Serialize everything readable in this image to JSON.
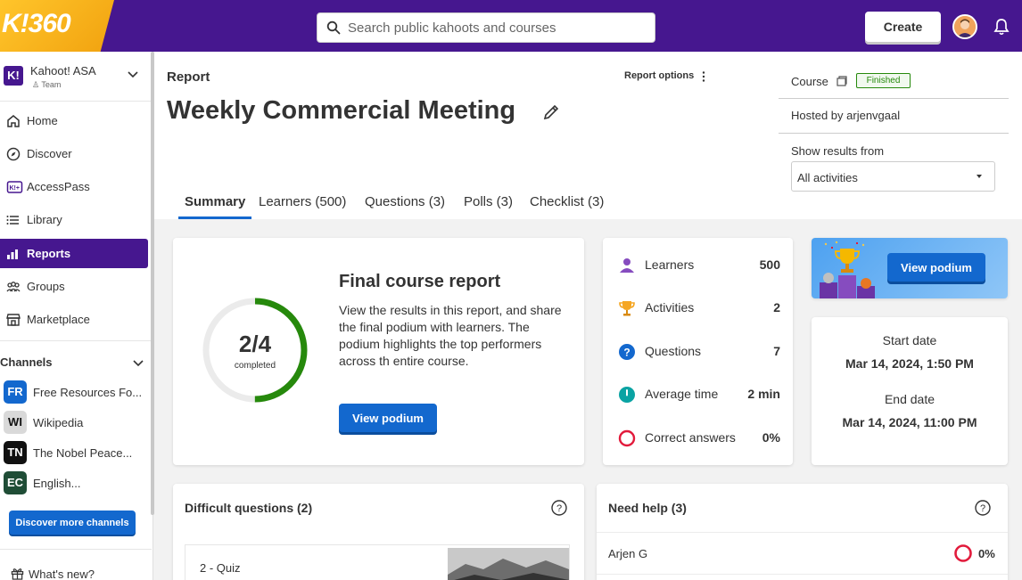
{
  "app": {
    "logo_text": "K!360",
    "search_placeholder": "Search public kahoots and courses",
    "create_label": "Create"
  },
  "sidebar": {
    "org_name": "Kahoot! ASA",
    "org_sub": "Team",
    "nav": [
      {
        "label": "Home",
        "icon": "home-icon"
      },
      {
        "label": "Discover",
        "icon": "compass-icon"
      },
      {
        "label": "AccessPass",
        "icon": "accesspass-icon"
      },
      {
        "label": "Library",
        "icon": "list-icon"
      },
      {
        "label": "Reports",
        "icon": "bar-chart-icon",
        "active": true
      },
      {
        "label": "Groups",
        "icon": "people-icon"
      },
      {
        "label": "Marketplace",
        "icon": "store-icon"
      }
    ],
    "channels_heading": "Channels",
    "channels": [
      {
        "badge": "FR",
        "label": "Free Resources Fo...",
        "color": "#1368ce"
      },
      {
        "badge": "WI",
        "label": "Wikipedia",
        "color": "#d9d9d9"
      },
      {
        "badge": "TN",
        "label": "The Nobel Peace...",
        "color": "#111111"
      },
      {
        "badge": "EC",
        "label": "English...",
        "color": "#1f4d36"
      }
    ],
    "discover_more": "Discover more channels",
    "whats_new": "What's new?"
  },
  "header": {
    "section": "Report",
    "title": "Weekly Commercial Meeting",
    "report_options": "Report options",
    "course_label": "Course",
    "status": "Finished",
    "hosted_by": "Hosted by arjenvgaal",
    "show_results_label": "Show results from",
    "show_results_value": "All activities"
  },
  "tabs": [
    {
      "label": "Summary",
      "active": true
    },
    {
      "label": "Learners (500)"
    },
    {
      "label": "Questions (3)"
    },
    {
      "label": "Polls (3)"
    },
    {
      "label": "Checklist (3)"
    }
  ],
  "final_report": {
    "progress_label": "2/4",
    "progress_sub": "completed",
    "progress_done": 2,
    "progress_total": 4,
    "title": "Final course report",
    "text": "View the results in this report, and share the final podium with learners. The podium highlights the top performers across th entire course.",
    "button": "View podium"
  },
  "stats": [
    {
      "label": "Learners",
      "value": "500",
      "icon": "person-icon"
    },
    {
      "label": "Activities",
      "value": "2",
      "icon": "trophy-icon"
    },
    {
      "label": "Questions",
      "value": "7",
      "icon": "question-icon"
    },
    {
      "label": "Average time",
      "value": "2 min",
      "icon": "clock-icon"
    },
    {
      "label": "Correct answers",
      "value": "0%",
      "icon": "ring-icon"
    }
  ],
  "podium": {
    "button": "View podium"
  },
  "dates": {
    "start_label": "Start date",
    "start_value": "Mar 14, 2024, 1:50 PM",
    "end_label": "End date",
    "end_value": "Mar 14, 2024, 11:00 PM"
  },
  "difficult": {
    "title": "Difficult questions (2)",
    "rows": [
      {
        "label": "2 - Quiz"
      }
    ]
  },
  "need_help": {
    "title": "Need help (3)",
    "rows": [
      {
        "name": "Arjen G",
        "value": "0%"
      }
    ]
  },
  "colors": {
    "brand_purple": "#46178f",
    "primary_blue": "#1368ce",
    "success_green": "#26890c",
    "danger_red": "#e21b3c",
    "accent_yellow": "#ffc52b"
  }
}
